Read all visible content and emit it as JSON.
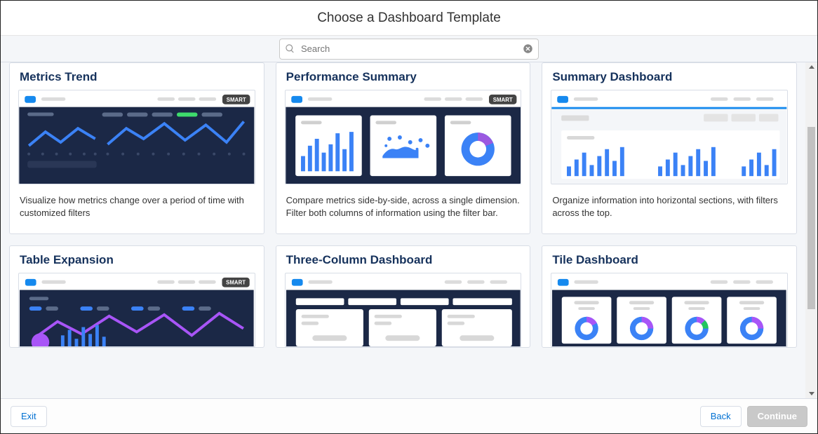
{
  "header": {
    "title": "Choose a Dashboard Template"
  },
  "search": {
    "placeholder": "Search"
  },
  "badges": {
    "smart": "SMART"
  },
  "templates": [
    {
      "title": "Metrics Trend",
      "desc": "Visualize how metrics change over a period of time with customized filters",
      "smart": true,
      "preview": "metrics-trend"
    },
    {
      "title": "Performance Summary",
      "desc": "Compare metrics side-by-side, across a single dimension. Filter both columns of information using the filter bar.",
      "smart": true,
      "preview": "performance-summary"
    },
    {
      "title": "Summary Dashboard",
      "desc": "Organize information into horizontal sections, with filters across the top.",
      "smart": false,
      "preview": "summary-dashboard"
    },
    {
      "title": "Table Expansion",
      "desc": "",
      "smart": true,
      "preview": "table-expansion"
    },
    {
      "title": "Three-Column Dashboard",
      "desc": "",
      "smart": false,
      "preview": "three-column"
    },
    {
      "title": "Tile Dashboard",
      "desc": "",
      "smart": false,
      "preview": "tile-dashboard"
    }
  ],
  "footer": {
    "exit": "Exit",
    "back": "Back",
    "continue": "Continue"
  }
}
